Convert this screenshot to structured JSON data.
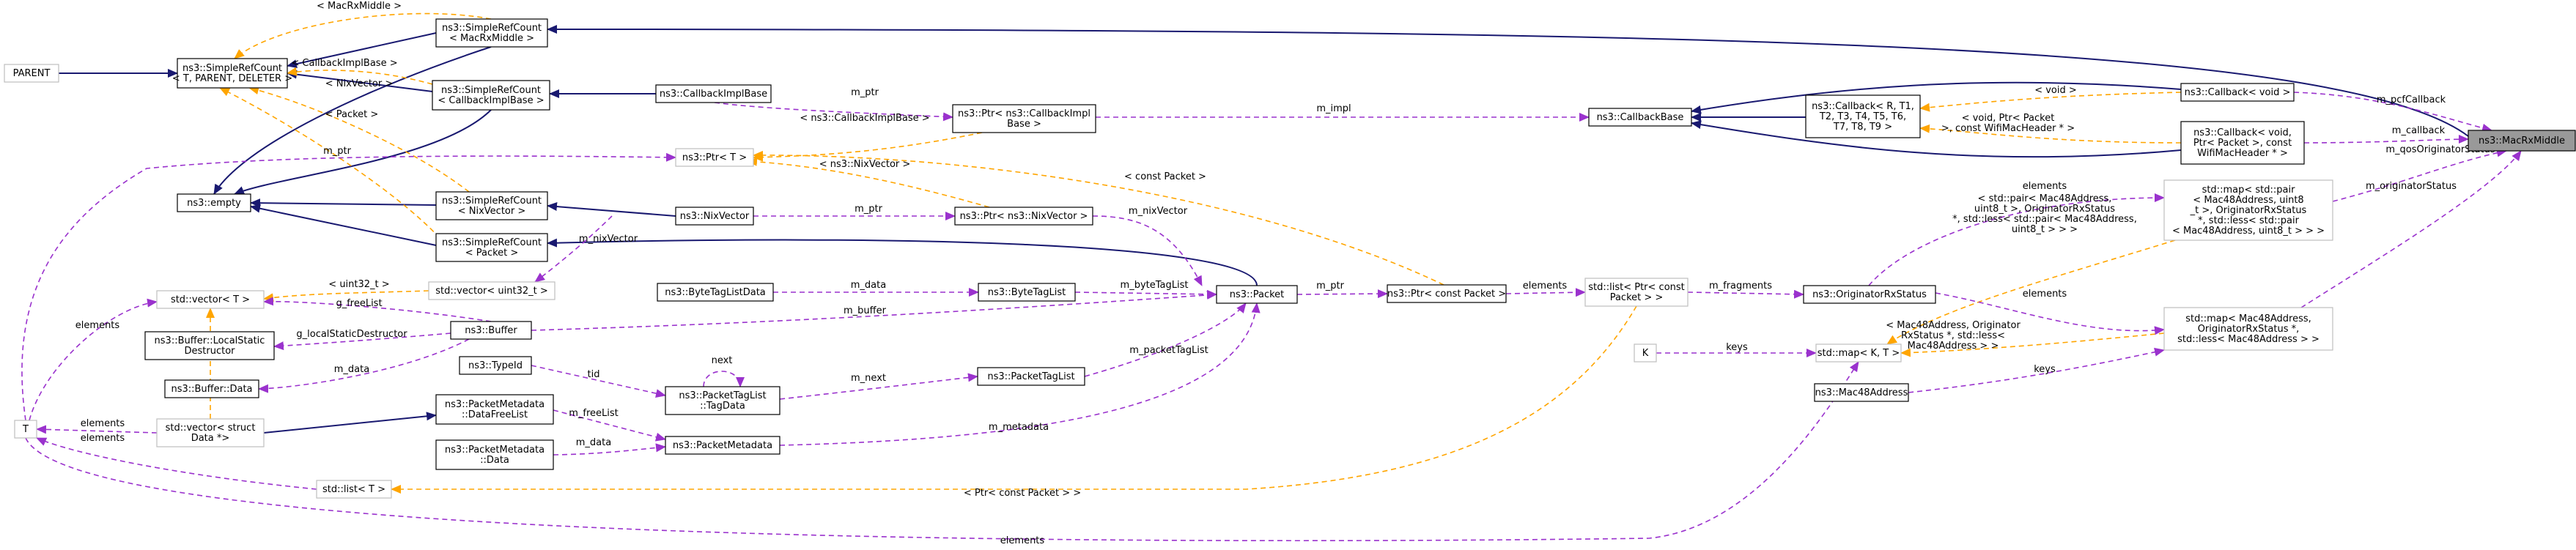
{
  "colors": {
    "inheritance": "#191970",
    "usage": "#9a32cd",
    "template": "#ffa500",
    "external_border": "#bfbfbf",
    "focus_fill": "#999999"
  },
  "nodes": [
    {
      "id": "macrx",
      "lines": [
        "ns3::MacRxMiddle"
      ],
      "kind": "focus"
    },
    {
      "id": "parent",
      "lines": [
        "PARENT"
      ],
      "kind": "ext"
    },
    {
      "id": "simplerefcount",
      "lines": [
        "ns3::SimpleRefCount",
        "< T, PARENT, DELETER >"
      ],
      "kind": "normal"
    },
    {
      "id": "src_macrx",
      "lines": [
        "ns3::SimpleRefCount",
        "< MacRxMiddle >"
      ],
      "kind": "normal"
    },
    {
      "id": "src_cbimpl",
      "lines": [
        "ns3::SimpleRefCount",
        "< CallbackImplBase >"
      ],
      "kind": "normal"
    },
    {
      "id": "src_nix",
      "lines": [
        "ns3::SimpleRefCount",
        "< NixVector >"
      ],
      "kind": "normal"
    },
    {
      "id": "src_packet",
      "lines": [
        "ns3::SimpleRefCount",
        "< Packet >"
      ],
      "kind": "normal"
    },
    {
      "id": "empty",
      "lines": [
        "ns3::empty"
      ],
      "kind": "normal"
    },
    {
      "id": "cbimplbase",
      "lines": [
        "ns3::CallbackImplBase"
      ],
      "kind": "normal"
    },
    {
      "id": "ptr_cbimpl",
      "lines": [
        "ns3::Ptr< ns3::CallbackImpl",
        "Base >"
      ],
      "kind": "normal"
    },
    {
      "id": "ptr_t",
      "lines": [
        "ns3::Ptr< T >"
      ],
      "kind": "ext"
    },
    {
      "id": "nixvector",
      "lines": [
        "ns3::NixVector"
      ],
      "kind": "normal"
    },
    {
      "id": "ptr_nix",
      "lines": [
        "ns3::Ptr< ns3::NixVector >"
      ],
      "kind": "normal"
    },
    {
      "id": "callbackbase",
      "lines": [
        "ns3::CallbackBase"
      ],
      "kind": "normal"
    },
    {
      "id": "callback_tpl",
      "lines": [
        "ns3::Callback< R, T1,",
        "T2, T3, T4, T5, T6,",
        "T7, T8, T9 >"
      ],
      "kind": "normal"
    },
    {
      "id": "callback_void",
      "lines": [
        "ns3::Callback< void >"
      ],
      "kind": "normal"
    },
    {
      "id": "callback_void_pkt",
      "lines": [
        "ns3::Callback< void,",
        "Ptr< Packet >, const",
        "WifiMacHeader * >"
      ],
      "kind": "normal"
    },
    {
      "id": "vector_t",
      "lines": [
        "std::vector< T >"
      ],
      "kind": "ext"
    },
    {
      "id": "vector_u32",
      "lines": [
        "std::vector< uint32_t >"
      ],
      "kind": "ext"
    },
    {
      "id": "buf_lsd",
      "lines": [
        "ns3::Buffer::LocalStatic",
        "Destructor"
      ],
      "kind": "normal"
    },
    {
      "id": "buf_data",
      "lines": [
        "ns3::Buffer::Data"
      ],
      "kind": "normal"
    },
    {
      "id": "buffer",
      "lines": [
        "ns3::Buffer"
      ],
      "kind": "normal"
    },
    {
      "id": "btld",
      "lines": [
        "ns3::ByteTagListData"
      ],
      "kind": "normal"
    },
    {
      "id": "btl",
      "lines": [
        "ns3::ByteTagList"
      ],
      "kind": "normal"
    },
    {
      "id": "packet",
      "lines": [
        "ns3::Packet"
      ],
      "kind": "normal"
    },
    {
      "id": "ptr_const_packet",
      "lines": [
        "ns3::Ptr< const Packet >"
      ],
      "kind": "normal"
    },
    {
      "id": "typeid",
      "lines": [
        "ns3::TypeId"
      ],
      "kind": "normal"
    },
    {
      "id": "ptl_tagdata",
      "lines": [
        "ns3::PacketTagList",
        "::TagData"
      ],
      "kind": "normal"
    },
    {
      "id": "ptl",
      "lines": [
        "ns3::PacketTagList"
      ],
      "kind": "normal"
    },
    {
      "id": "pm_dfl",
      "lines": [
        "ns3::PacketMetadata",
        "::DataFreeList"
      ],
      "kind": "normal"
    },
    {
      "id": "vector_struct",
      "lines": [
        "std::vector< struct",
        "Data *>"
      ],
      "kind": "ext"
    },
    {
      "id": "pm_data",
      "lines": [
        "ns3::PacketMetadata",
        "::Data"
      ],
      "kind": "normal"
    },
    {
      "id": "pm",
      "lines": [
        "ns3::PacketMetadata"
      ],
      "kind": "normal"
    },
    {
      "id": "t",
      "lines": [
        "T"
      ],
      "kind": "ext"
    },
    {
      "id": "list_t",
      "lines": [
        "std::list< T >"
      ],
      "kind": "ext"
    },
    {
      "id": "list_ptr",
      "lines": [
        "std::list< Ptr< const",
        "Packet > >"
      ],
      "kind": "ext"
    },
    {
      "id": "ors",
      "lines": [
        "ns3::OriginatorRxStatus"
      ],
      "kind": "normal"
    },
    {
      "id": "map_pair",
      "lines": [
        "std::map< std::pair",
        "< Mac48Address, uint8",
        "_t >, OriginatorRxStatus",
        "*, std::less< std::pair",
        "< Mac48Address, uint8_t > > >"
      ],
      "kind": "ext"
    },
    {
      "id": "map_mac",
      "lines": [
        "std::map< Mac48Address,",
        "OriginatorRxStatus *,",
        "std::less< Mac48Address > >"
      ],
      "kind": "ext"
    },
    {
      "id": "k",
      "lines": [
        "K"
      ],
      "kind": "ext"
    },
    {
      "id": "map_kt",
      "lines": [
        "std::map< K, T >"
      ],
      "kind": "ext"
    },
    {
      "id": "mac48",
      "lines": [
        "ns3::Mac48Address"
      ],
      "kind": "normal"
    }
  ],
  "edges": [
    {
      "id": "e1",
      "type": "inh",
      "from": "parent",
      "to": "simplerefcount",
      "label": []
    },
    {
      "id": "e2",
      "type": "inh",
      "from": "src_macrx",
      "to": "simplerefcount",
      "label": []
    },
    {
      "id": "e3",
      "type": "inh",
      "from": "macrx",
      "to": "src_macrx",
      "label": []
    },
    {
      "id": "e4",
      "type": "inh",
      "from": "src_cbimpl",
      "to": "simplerefcount",
      "label": []
    },
    {
      "id": "e5",
      "type": "inh",
      "from": "cbimplbase",
      "to": "src_cbimpl",
      "label": []
    },
    {
      "id": "e6",
      "type": "inh",
      "from": "src_nix",
      "to": "empty",
      "label": []
    },
    {
      "id": "e7",
      "type": "inh",
      "from": "nixvector",
      "to": "src_nix",
      "label": []
    },
    {
      "id": "e8",
      "type": "inh",
      "from": "src_packet",
      "to": "empty",
      "label": []
    },
    {
      "id": "e9",
      "type": "inh",
      "from": "packet",
      "to": "src_packet",
      "label": []
    },
    {
      "id": "e10",
      "type": "inh",
      "from": "src_macrx",
      "to": "empty",
      "label": []
    },
    {
      "id": "e11",
      "type": "inh",
      "from": "src_cbimpl",
      "to": "empty",
      "label": []
    },
    {
      "id": "e12",
      "type": "inh",
      "from": "callback_tpl",
      "to": "callbackbase",
      "label": []
    },
    {
      "id": "e13",
      "type": "inh",
      "from": "callback_void",
      "to": "callbackbase",
      "label": []
    },
    {
      "id": "e14",
      "type": "inh",
      "from": "callback_void_pkt",
      "to": "callbackbase",
      "label": []
    },
    {
      "id": "e15",
      "type": "inh",
      "from": "vector_struct",
      "to": "pm_dfl",
      "label": []
    },
    {
      "id": "t1",
      "type": "tpl",
      "from": "src_macrx",
      "to": "simplerefcount",
      "label": [
        "< MacRxMiddle >"
      ]
    },
    {
      "id": "t2",
      "type": "tpl",
      "from": "src_cbimpl",
      "to": "simplerefcount",
      "label": [
        "< CallbackImplBase >"
      ]
    },
    {
      "id": "t3",
      "type": "tpl",
      "from": "src_nix",
      "to": "simplerefcount",
      "label": [
        "< NixVector >"
      ]
    },
    {
      "id": "t4",
      "type": "tpl",
      "from": "src_packet",
      "to": "simplerefcount",
      "label": [
        "< Packet >"
      ]
    },
    {
      "id": "t5",
      "type": "tpl",
      "from": "ptr_cbimpl",
      "to": "ptr_t",
      "label": [
        "< ns3::CallbackImplBase >"
      ]
    },
    {
      "id": "t6",
      "type": "tpl",
      "from": "ptr_nix",
      "to": "ptr_t",
      "label": [
        "< ns3::NixVector >"
      ]
    },
    {
      "id": "t7",
      "type": "tpl",
      "from": "ptr_const_packet",
      "to": "ptr_t",
      "label": [
        "< const Packet >"
      ]
    },
    {
      "id": "t8",
      "type": "tpl",
      "from": "callback_void",
      "to": "callback_tpl",
      "label": [
        "< void >"
      ]
    },
    {
      "id": "t9",
      "type": "tpl",
      "from": "callback_void_pkt",
      "to": "callback_tpl",
      "label": [
        "< void, Ptr< Packet",
        ">, const WifiMacHeader * >"
      ]
    },
    {
      "id": "t10",
      "type": "tpl",
      "from": "vector_u32",
      "to": "vector_t",
      "label": [
        "< uint32_t >"
      ]
    },
    {
      "id": "t11",
      "type": "tpl",
      "from": "vector_struct",
      "to": "vector_t",
      "label": []
    },
    {
      "id": "t12",
      "type": "tpl",
      "from": "list_ptr",
      "to": "list_t",
      "label": [
        "< Ptr< const Packet > >"
      ]
    },
    {
      "id": "t13",
      "type": "tpl",
      "from": "map_pair",
      "to": "map_kt",
      "label": [
        "< std::pair< Mac48Address,",
        "uint8_t >, OriginatorRxStatus",
        "*, std::less< std::pair< Mac48Address,",
        "uint8_t > > >"
      ]
    },
    {
      "id": "t14",
      "type": "tpl",
      "from": "map_mac",
      "to": "map_kt",
      "label": [
        "< Mac48Address, Originator",
        "RxStatus *, std::less<",
        "Mac48Address > >"
      ]
    },
    {
      "id": "u1",
      "type": "use",
      "from": "callback_void",
      "to": "macrx",
      "label": [
        "m_pcfCallback"
      ]
    },
    {
      "id": "u2",
      "type": "use",
      "from": "callback_void_pkt",
      "to": "macrx",
      "label": [
        "m_callback"
      ]
    },
    {
      "id": "u3",
      "type": "use",
      "from": "map_pair",
      "to": "macrx",
      "label": [
        "m_qosOriginatorStatus"
      ]
    },
    {
      "id": "u4",
      "type": "use",
      "from": "map_mac",
      "to": "macrx",
      "label": [
        "m_originatorStatus"
      ]
    },
    {
      "id": "u5",
      "type": "use",
      "from": "ptr_cbimpl",
      "to": "callbackbase",
      "label": [
        "m_impl"
      ]
    },
    {
      "id": "u6",
      "type": "use",
      "from": "cbimplbase",
      "to": "ptr_cbimpl",
      "label": [
        "m_ptr"
      ]
    },
    {
      "id": "u7",
      "type": "use",
      "from": "t",
      "to": "ptr_t",
      "label": [
        "m_ptr"
      ]
    },
    {
      "id": "u8",
      "type": "use",
      "from": "nixvector",
      "to": "ptr_nix",
      "label": [
        "m_ptr"
      ]
    },
    {
      "id": "u9",
      "type": "use",
      "from": "ptr_nix",
      "to": "packet",
      "label": [
        "m_nixVector"
      ]
    },
    {
      "id": "u10",
      "type": "use",
      "from": "vector_u32",
      "to": "nixvector",
      "label": [
        "m_nixVector"
      ]
    },
    {
      "id": "u11",
      "type": "use",
      "from": "t",
      "to": "vector_t",
      "label": [
        "elements"
      ]
    },
    {
      "id": "u12",
      "type": "use",
      "from": "vector_t",
      "to": "buffer",
      "label": [
        "g_freeList"
      ]
    },
    {
      "id": "u13",
      "type": "use",
      "from": "buf_lsd",
      "to": "buffer",
      "label": [
        "g_localStaticDestructor"
      ]
    },
    {
      "id": "u14",
      "type": "use",
      "from": "buf_data",
      "to": "buffer",
      "label": [
        "m_data"
      ]
    },
    {
      "id": "u15",
      "type": "use",
      "from": "buffer",
      "to": "packet",
      "label": [
        "m_buffer"
      ]
    },
    {
      "id": "u16",
      "type": "use",
      "from": "btld",
      "to": "btl",
      "label": [
        "m_data"
      ]
    },
    {
      "id": "u17",
      "type": "use",
      "from": "btl",
      "to": "packet",
      "label": [
        "m_byteTagList"
      ]
    },
    {
      "id": "u18",
      "type": "use",
      "from": "packet",
      "to": "ptr_const_packet",
      "label": [
        "m_ptr"
      ]
    },
    {
      "id": "u19",
      "type": "use",
      "from": "ptr_const_packet",
      "to": "list_ptr",
      "label": [
        "elements"
      ]
    },
    {
      "id": "u20",
      "type": "use",
      "from": "list_ptr",
      "to": "ors",
      "label": [
        "m_fragments"
      ]
    },
    {
      "id": "u21",
      "type": "use",
      "from": "ors",
      "to": "map_pair",
      "label": [
        "elements"
      ]
    },
    {
      "id": "u22",
      "type": "use",
      "from": "ors",
      "to": "map_mac",
      "label": [
        "elements"
      ]
    },
    {
      "id": "u23",
      "type": "use",
      "from": "typeid",
      "to": "ptl_tagdata",
      "label": [
        "tid"
      ]
    },
    {
      "id": "u24",
      "type": "use",
      "from": "ptl_tagdata",
      "to": "ptl_tagdata",
      "label": [
        "next"
      ]
    },
    {
      "id": "u25",
      "type": "use",
      "from": "ptl_tagdata",
      "to": "ptl",
      "label": [
        "m_next"
      ]
    },
    {
      "id": "u26",
      "type": "use",
      "from": "ptl",
      "to": "packet",
      "label": [
        "m_packetTagList"
      ]
    },
    {
      "id": "u27",
      "type": "use",
      "from": "pm_dfl",
      "to": "pm",
      "label": [
        "m_freeList"
      ]
    },
    {
      "id": "u28",
      "type": "use",
      "from": "pm_data",
      "to": "pm",
      "label": [
        "m_data"
      ]
    },
    {
      "id": "u29",
      "type": "use",
      "from": "pm",
      "to": "packet",
      "label": [
        "m_metadata"
      ]
    },
    {
      "id": "u30",
      "type": "use",
      "from": "t",
      "to": "vector_struct",
      "label": [
        "elements"
      ]
    },
    {
      "id": "u31",
      "type": "use",
      "from": "t",
      "to": "list_t",
      "label": [
        "elements"
      ]
    },
    {
      "id": "u32",
      "type": "use",
      "from": "k",
      "to": "map_kt",
      "label": [
        "keys"
      ]
    },
    {
      "id": "u33",
      "type": "use",
      "from": "t",
      "to": "map_kt",
      "label": [
        "elements"
      ]
    },
    {
      "id": "u34",
      "type": "use",
      "from": "mac48",
      "to": "map_mac",
      "label": [
        "keys"
      ]
    }
  ]
}
